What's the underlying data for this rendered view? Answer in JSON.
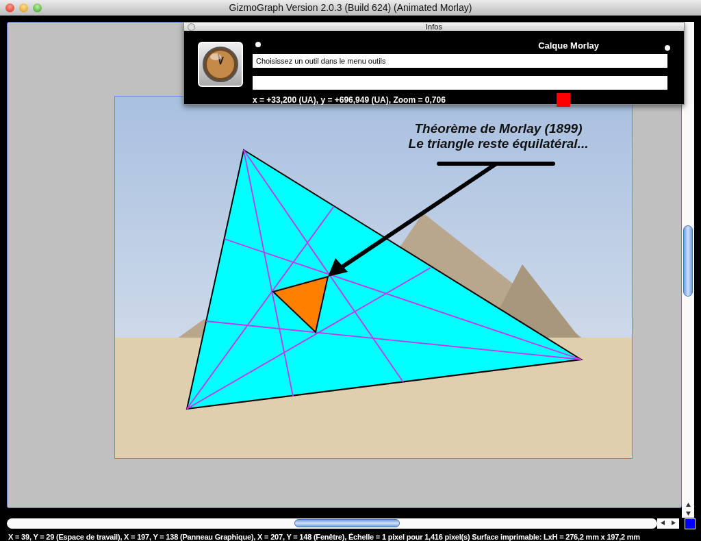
{
  "window": {
    "title": "GizmoGraph  Version  2.0.3 (Build 624) (Animated Morlay)"
  },
  "infos": {
    "title": "Infos",
    "layer_name": "Calque Morlay",
    "message": "Choisissez un outil dans le menu outils",
    "coordinates": "x = +33,200 (UA), y = +696,949 (UA), Zoom = 0,706",
    "color": "#ff0000"
  },
  "canvas": {
    "annotation": [
      "Théorème de Morlay (1899)",
      "Le triangle reste équilatéral..."
    ]
  },
  "status_bar": "X = 39, Y = 29 (Espace de travail),  X = 197, Y = 138 (Panneau Graphique),  X = 207, Y = 148 (Fenêtre), Échelle = 1 pixel pour 1,416 pixel(s) Surface imprimable: LxH = 276,2 mm x 197,2 mm"
}
